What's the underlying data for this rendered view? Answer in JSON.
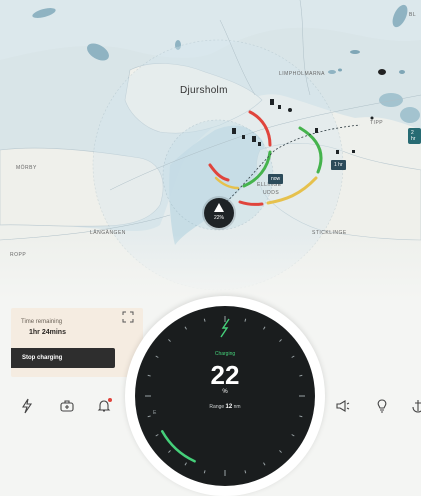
{
  "map": {
    "places": {
      "djursholm": "Djursholm",
      "limhamnsarna": "LIMPHOLMARNA",
      "morby": "MÖRBY",
      "langangen": "LÅNGÄNGEN",
      "sticklinge": "STICKLINGE",
      "udds": "UDDS",
      "ellinge": "ELLINGE",
      "ropp": "ROPP",
      "tipp": "TIPP",
      "bl": "BL"
    },
    "eta_badges": [
      "now",
      "1 hr"
    ],
    "edge_badge": "2 hr",
    "boat": {
      "battery": "22%"
    }
  },
  "charging_card": {
    "time_label": "Time remaining",
    "time_value": "1hr 24mins",
    "stop_label": "Stop charging",
    "expand_icon": "expand-icon"
  },
  "gauge": {
    "status": "Charging",
    "value": "22",
    "unit": "%",
    "range_label": "Range",
    "range_value": "12",
    "range_unit": "nm",
    "left_marker": "E",
    "accent": "#45d07a",
    "level": 0.22
  },
  "toolbar": {
    "icons": [
      "lightning-icon",
      "battery-icon",
      "bell-icon",
      "horn-icon",
      "light-bulb-icon",
      "anchor-icon"
    ]
  }
}
